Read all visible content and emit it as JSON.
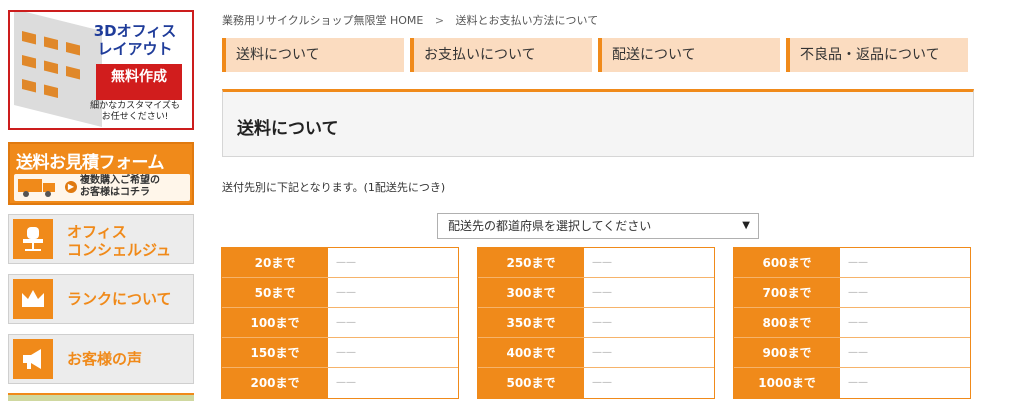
{
  "sidebar": {
    "banner_3d": {
      "title_line1": "3Dオフィス",
      "title_line2": "レイアウト",
      "badge": "無料作成",
      "sub_line1": "細かなカスタマイズも",
      "sub_line2": "お任せください!"
    },
    "banner_quote": {
      "title": "送料お見積フォーム",
      "sub_line1": "複数購入ご希望の",
      "sub_line2": "お客様はコチラ"
    },
    "buttons": [
      {
        "line1": "オフィス",
        "line2": "コンシェルジュ",
        "icon": "office-chair-icon"
      },
      {
        "line1": "ランクについて",
        "line2": "",
        "icon": "crown-icon"
      },
      {
        "line1": "お客様の声",
        "line2": "",
        "icon": "megaphone-icon"
      }
    ]
  },
  "breadcrumb": {
    "home": "業務用リサイクルショップ無限堂 HOME",
    "separator": ">",
    "current": "送料とお支払い方法について"
  },
  "tabs": [
    "送料について",
    "お支払いについて",
    "配送について",
    "不良品・返品について"
  ],
  "heading": "送料について",
  "intro": "送付先別に下記となります。(1配送先につき)",
  "select": {
    "value": "配送先の都道府県を選択してください",
    "caret": "▼"
  },
  "rate_tables": [
    [
      {
        "label": "20まで",
        "value": "——"
      },
      {
        "label": "50まで",
        "value": "——"
      },
      {
        "label": "100まで",
        "value": "——"
      },
      {
        "label": "150まで",
        "value": "——"
      },
      {
        "label": "200まで",
        "value": "——"
      }
    ],
    [
      {
        "label": "250まで",
        "value": "——"
      },
      {
        "label": "300まで",
        "value": "——"
      },
      {
        "label": "350まで",
        "value": "——"
      },
      {
        "label": "400まで",
        "value": "——"
      },
      {
        "label": "500まで",
        "value": "——"
      }
    ],
    [
      {
        "label": "600まで",
        "value": "——"
      },
      {
        "label": "700まで",
        "value": "——"
      },
      {
        "label": "800まで",
        "value": "——"
      },
      {
        "label": "900まで",
        "value": "——"
      },
      {
        "label": "1000まで",
        "value": "——"
      }
    ]
  ],
  "colors": {
    "accent": "#f08a1a",
    "tab_bg": "#fbdcc0",
    "banner_red": "#d11d1d",
    "banner_blue": "#1f3c9a"
  }
}
